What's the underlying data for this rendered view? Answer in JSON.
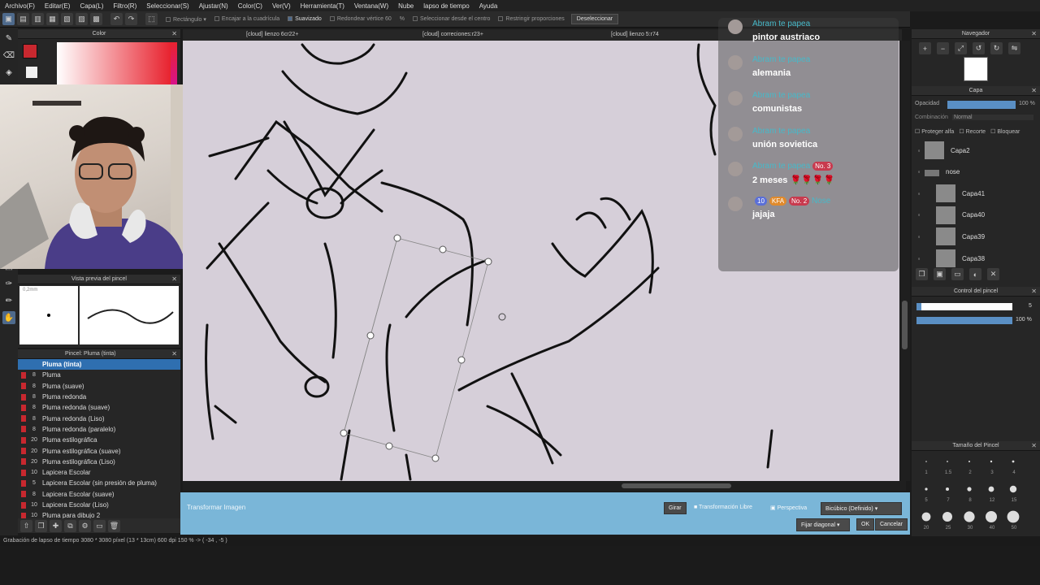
{
  "menu": [
    "Archivo(F)",
    "Editar(E)",
    "Capa(L)",
    "Filtro(R)",
    "Seleccionar(S)",
    "Ajustar(N)",
    "Color(C)",
    "Ver(V)",
    "Herramienta(T)",
    "Ventana(W)",
    "Nube",
    "lapso de tiempo",
    "Ayuda"
  ],
  "tool_options": {
    "shape": "Rectángulo",
    "snap_grid": "Encajar a la cuadrícula",
    "smooth": "Suavizado",
    "round_corners": "Redondear vértice",
    "round_value": "60",
    "percent": "%",
    "from_center": "Seleccionar desde el centro",
    "restrict": "Restringir proporciones",
    "deselect": "Deseleccionar"
  },
  "color_panel": {
    "title": "Color",
    "main_color": "#c8282f"
  },
  "brush_preview": {
    "title": "Vista previa del pincel",
    "size_label": "0,2mm"
  },
  "brush_list": {
    "title": "Pincel: Pluma (tinta)",
    "items": [
      {
        "size": "",
        "name": "Pluma (tinta)",
        "active": true
      },
      {
        "size": "8",
        "name": "Pluma"
      },
      {
        "size": "8",
        "name": "Pluma (suave)"
      },
      {
        "size": "8",
        "name": "Pluma redonda"
      },
      {
        "size": "8",
        "name": "Pluma redonda (suave)"
      },
      {
        "size": "8",
        "name": "Pluma redonda (Liso)"
      },
      {
        "size": "8",
        "name": "Pluma redonda (paralelo)"
      },
      {
        "size": "20",
        "name": "Pluma estilográfica"
      },
      {
        "size": "20",
        "name": "Pluma estilográfica (suave)"
      },
      {
        "size": "20",
        "name": "Pluma estilográfica (Liso)"
      },
      {
        "size": "10",
        "name": "Lapicera Escolar"
      },
      {
        "size": "5",
        "name": "Lapicera Escolar (sin presión de pluma)"
      },
      {
        "size": "8",
        "name": "Lapicera Escolar (suave)"
      },
      {
        "size": "10",
        "name": "Lapicera Escolar (Liso)"
      },
      {
        "size": "10",
        "name": "Pluma para dibujo 2"
      }
    ]
  },
  "tabs": [
    "[cloud] lienzo 6cr22+",
    "[cloud] correciones:r23+",
    "[cloud] lienzo 5:r74"
  ],
  "chat": [
    {
      "name": "Abram te papea",
      "text": "pintor austriaco",
      "badges": []
    },
    {
      "name": "Abram te papea",
      "text": "alemania",
      "badges": []
    },
    {
      "name": "Abram te papea",
      "text": "comunistas",
      "badges": []
    },
    {
      "name": "Abram te papea",
      "text": "unión sovietica",
      "badges": []
    },
    {
      "name": "Abram te papea",
      "text": "2 meses 🌹🌹🌹🌹",
      "badges": [
        "No. 3"
      ]
    },
    {
      "name": "Nose",
      "text": "jajaja",
      "badges": [
        "10",
        "KFA",
        "No. 2"
      ]
    }
  ],
  "navigator": {
    "title": "Navegador"
  },
  "layers": {
    "title": "Capa",
    "opacity_label": "Opacidad",
    "opacity_value": "100 %",
    "blend_label": "Combinación",
    "blend_value": "Normal",
    "protect_alpha": "Proteger alfa",
    "clip": "Recorte",
    "lock": "Bloquear",
    "items": [
      "Capa2",
      "nose",
      "Capa41",
      "Capa40",
      "Capa39",
      "Capa38"
    ]
  },
  "brush_control": {
    "title": "Control del pincel",
    "size_value": "5",
    "opacity_value": "100 %"
  },
  "brush_size": {
    "title": "Tamaño del Pincel",
    "row1": [
      "1",
      "1.5",
      "2",
      "3",
      "4"
    ],
    "row2": [
      "5",
      "7",
      "8",
      "12",
      "15"
    ],
    "row3": [
      "20",
      "25",
      "30",
      "40",
      "50"
    ]
  },
  "transform": {
    "label": "Transformar Imagen",
    "rotate": "Girar",
    "free": "Transformación Libre",
    "perspective": "Perspectiva",
    "interp": "Bicúbico (Definido)",
    "fix": "Fijar diagonal",
    "ok": "OK",
    "cancel": "Cancelar"
  },
  "status": "Grabación de lapso de tiempo 3080 * 3080 píxel (13 * 13cm) 600 dpi 150 % -> ( -34 , -5 )"
}
